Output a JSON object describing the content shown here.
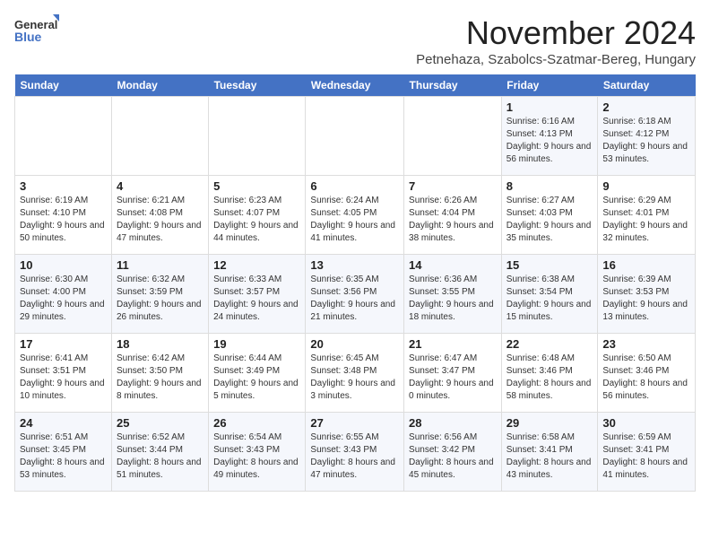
{
  "logo": {
    "line1": "General",
    "line2": "Blue"
  },
  "title": "November 2024",
  "subtitle": "Petnehaza, Szabolcs-Szatmar-Bereg, Hungary",
  "days_of_week": [
    "Sunday",
    "Monday",
    "Tuesday",
    "Wednesday",
    "Thursday",
    "Friday",
    "Saturday"
  ],
  "weeks": [
    [
      {
        "day": "",
        "info": ""
      },
      {
        "day": "",
        "info": ""
      },
      {
        "day": "",
        "info": ""
      },
      {
        "day": "",
        "info": ""
      },
      {
        "day": "",
        "info": ""
      },
      {
        "day": "1",
        "info": "Sunrise: 6:16 AM\nSunset: 4:13 PM\nDaylight: 9 hours and 56 minutes."
      },
      {
        "day": "2",
        "info": "Sunrise: 6:18 AM\nSunset: 4:12 PM\nDaylight: 9 hours and 53 minutes."
      }
    ],
    [
      {
        "day": "3",
        "info": "Sunrise: 6:19 AM\nSunset: 4:10 PM\nDaylight: 9 hours and 50 minutes."
      },
      {
        "day": "4",
        "info": "Sunrise: 6:21 AM\nSunset: 4:08 PM\nDaylight: 9 hours and 47 minutes."
      },
      {
        "day": "5",
        "info": "Sunrise: 6:23 AM\nSunset: 4:07 PM\nDaylight: 9 hours and 44 minutes."
      },
      {
        "day": "6",
        "info": "Sunrise: 6:24 AM\nSunset: 4:05 PM\nDaylight: 9 hours and 41 minutes."
      },
      {
        "day": "7",
        "info": "Sunrise: 6:26 AM\nSunset: 4:04 PM\nDaylight: 9 hours and 38 minutes."
      },
      {
        "day": "8",
        "info": "Sunrise: 6:27 AM\nSunset: 4:03 PM\nDaylight: 9 hours and 35 minutes."
      },
      {
        "day": "9",
        "info": "Sunrise: 6:29 AM\nSunset: 4:01 PM\nDaylight: 9 hours and 32 minutes."
      }
    ],
    [
      {
        "day": "10",
        "info": "Sunrise: 6:30 AM\nSunset: 4:00 PM\nDaylight: 9 hours and 29 minutes."
      },
      {
        "day": "11",
        "info": "Sunrise: 6:32 AM\nSunset: 3:59 PM\nDaylight: 9 hours and 26 minutes."
      },
      {
        "day": "12",
        "info": "Sunrise: 6:33 AM\nSunset: 3:57 PM\nDaylight: 9 hours and 24 minutes."
      },
      {
        "day": "13",
        "info": "Sunrise: 6:35 AM\nSunset: 3:56 PM\nDaylight: 9 hours and 21 minutes."
      },
      {
        "day": "14",
        "info": "Sunrise: 6:36 AM\nSunset: 3:55 PM\nDaylight: 9 hours and 18 minutes."
      },
      {
        "day": "15",
        "info": "Sunrise: 6:38 AM\nSunset: 3:54 PM\nDaylight: 9 hours and 15 minutes."
      },
      {
        "day": "16",
        "info": "Sunrise: 6:39 AM\nSunset: 3:53 PM\nDaylight: 9 hours and 13 minutes."
      }
    ],
    [
      {
        "day": "17",
        "info": "Sunrise: 6:41 AM\nSunset: 3:51 PM\nDaylight: 9 hours and 10 minutes."
      },
      {
        "day": "18",
        "info": "Sunrise: 6:42 AM\nSunset: 3:50 PM\nDaylight: 9 hours and 8 minutes."
      },
      {
        "day": "19",
        "info": "Sunrise: 6:44 AM\nSunset: 3:49 PM\nDaylight: 9 hours and 5 minutes."
      },
      {
        "day": "20",
        "info": "Sunrise: 6:45 AM\nSunset: 3:48 PM\nDaylight: 9 hours and 3 minutes."
      },
      {
        "day": "21",
        "info": "Sunrise: 6:47 AM\nSunset: 3:47 PM\nDaylight: 9 hours and 0 minutes."
      },
      {
        "day": "22",
        "info": "Sunrise: 6:48 AM\nSunset: 3:46 PM\nDaylight: 8 hours and 58 minutes."
      },
      {
        "day": "23",
        "info": "Sunrise: 6:50 AM\nSunset: 3:46 PM\nDaylight: 8 hours and 56 minutes."
      }
    ],
    [
      {
        "day": "24",
        "info": "Sunrise: 6:51 AM\nSunset: 3:45 PM\nDaylight: 8 hours and 53 minutes."
      },
      {
        "day": "25",
        "info": "Sunrise: 6:52 AM\nSunset: 3:44 PM\nDaylight: 8 hours and 51 minutes."
      },
      {
        "day": "26",
        "info": "Sunrise: 6:54 AM\nSunset: 3:43 PM\nDaylight: 8 hours and 49 minutes."
      },
      {
        "day": "27",
        "info": "Sunrise: 6:55 AM\nSunset: 3:43 PM\nDaylight: 8 hours and 47 minutes."
      },
      {
        "day": "28",
        "info": "Sunrise: 6:56 AM\nSunset: 3:42 PM\nDaylight: 8 hours and 45 minutes."
      },
      {
        "day": "29",
        "info": "Sunrise: 6:58 AM\nSunset: 3:41 PM\nDaylight: 8 hours and 43 minutes."
      },
      {
        "day": "30",
        "info": "Sunrise: 6:59 AM\nSunset: 3:41 PM\nDaylight: 8 hours and 41 minutes."
      }
    ]
  ]
}
